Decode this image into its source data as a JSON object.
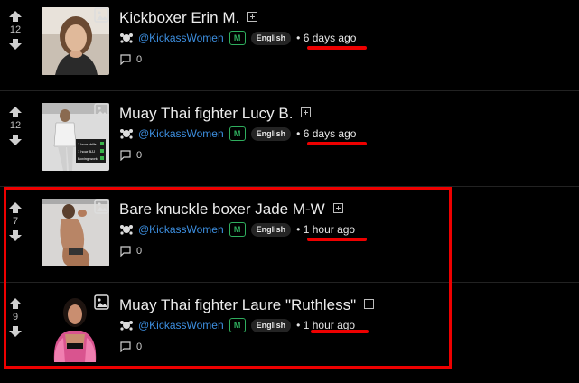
{
  "posts": [
    {
      "score": "12",
      "title": "Kickboxer Erin M.",
      "user": "@KickassWomen",
      "mod_badge": "M",
      "language": "English",
      "time": "6 days ago",
      "comments": "0"
    },
    {
      "score": "12",
      "title": "Muay Thai fighter Lucy B.",
      "user": "@KickassWomen",
      "mod_badge": "M",
      "language": "English",
      "time": "6 days ago",
      "comments": "0",
      "thumb_text": [
        "1 hour drills",
        "1 hour BJJ",
        "Boxing work"
      ]
    },
    {
      "score": "7",
      "title": "Bare knuckle boxer Jade M-W",
      "user": "@KickassWomen",
      "mod_badge": "M",
      "language": "English",
      "time": "1 hour ago",
      "comments": "0"
    },
    {
      "score": "9",
      "title": "Muay Thai fighter Laure \"Ruthless\"",
      "user": "@KickassWomen",
      "mod_badge": "M",
      "language": "English",
      "time": "1 hour ago",
      "comments": "0"
    }
  ],
  "colors": {
    "background": "#000000",
    "username": "#3d8fe0",
    "mod_badge": "#2fae5e",
    "annotation": "#ee0000"
  },
  "icons": [
    "upvote-arrow-icon",
    "downvote-arrow-icon",
    "image-icon",
    "expand-icon",
    "community-avatar-icon",
    "comment-icon"
  ]
}
